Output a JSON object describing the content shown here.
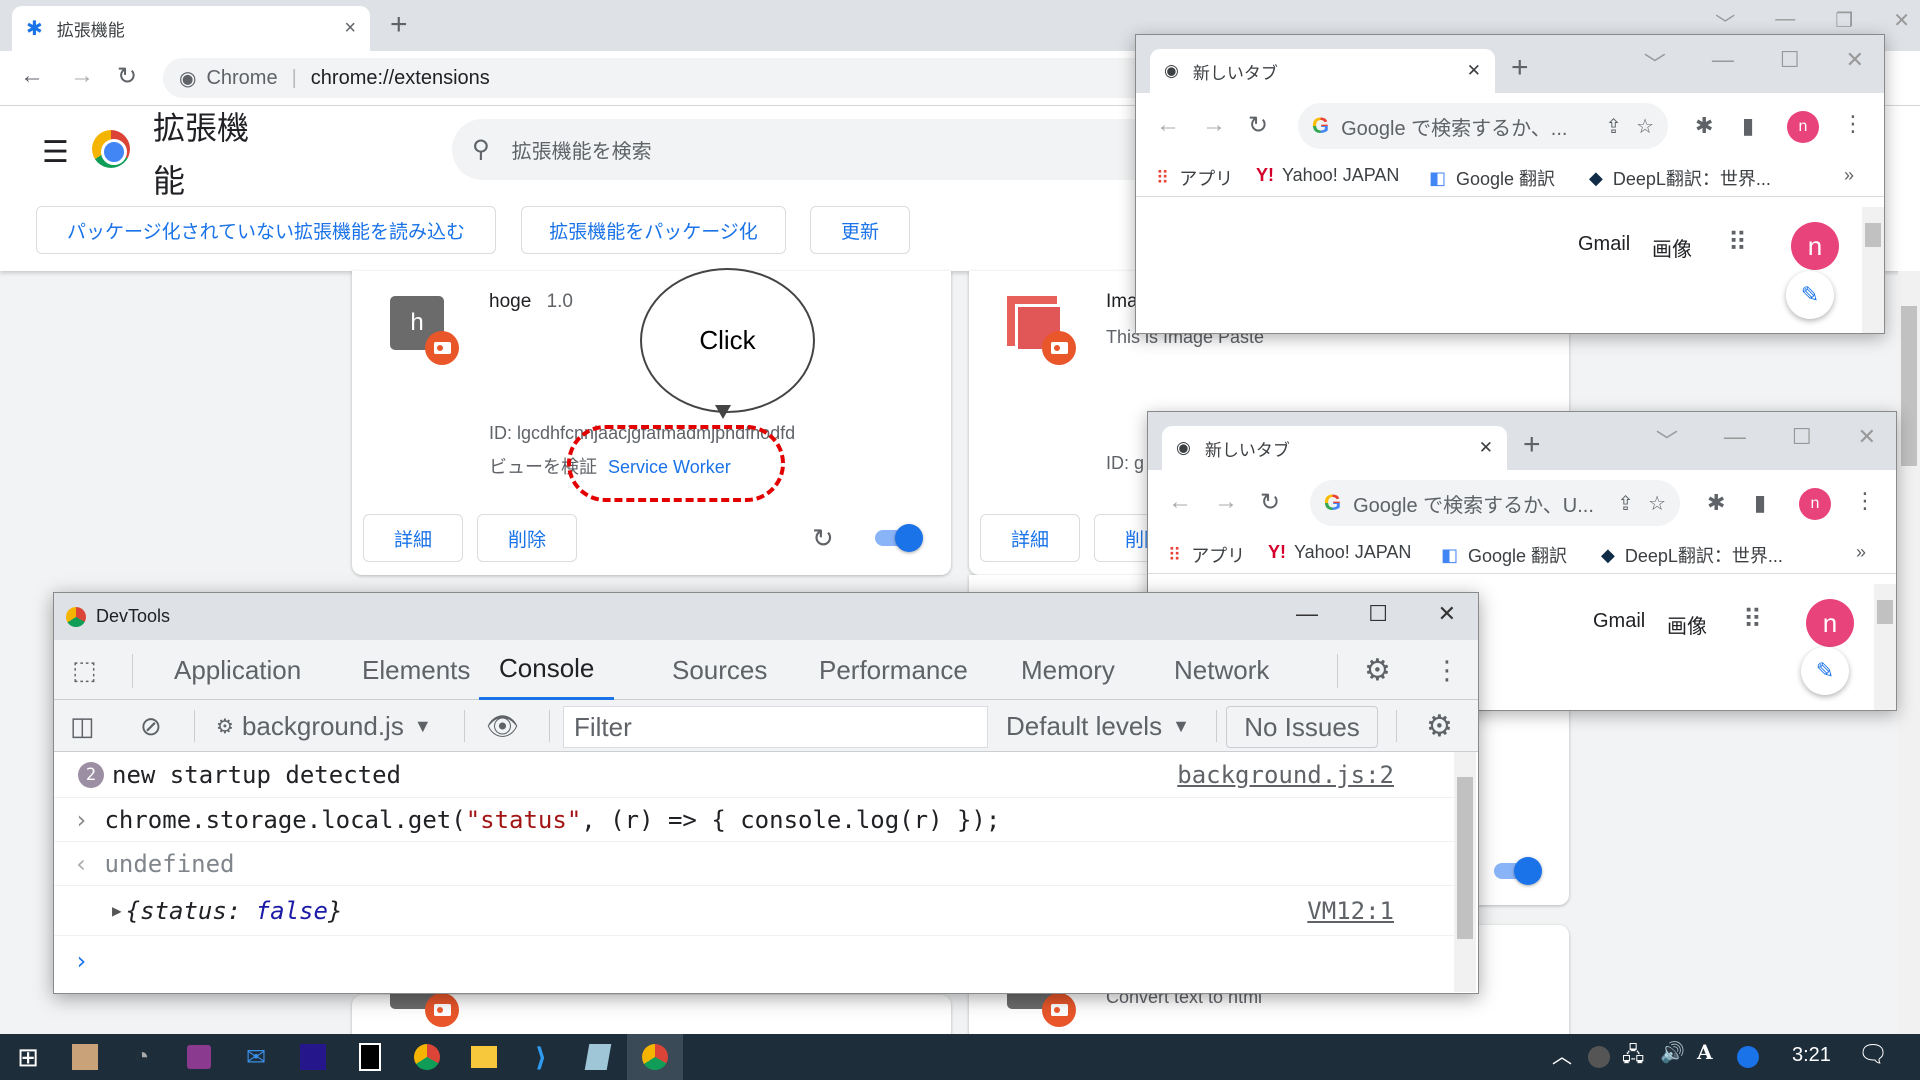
{
  "main_window": {
    "tab_title": "拡張機能",
    "tab_close": "×",
    "new_tab": "+",
    "omnibox_site": "Chrome",
    "omnibox_url": "chrome://extensions",
    "win_controls": [
      "﹀",
      "—",
      "❐",
      "✕"
    ]
  },
  "extensions_page": {
    "title": "拡張機能",
    "search_placeholder": "拡張機能を検索",
    "buttons": {
      "load_unpacked": "パッケージ化されていない拡張機能を読み込む",
      "pack": "拡張機能をパッケージ化",
      "update": "更新"
    },
    "cards": [
      {
        "icon_letter": "h",
        "name": "hoge",
        "version": "1.0",
        "id_text": "ID: lgcdhfcnnjaacjgfafmadmjpndfhodfd",
        "inspect_label": "ビューを検証",
        "inspect_link": "Service Worker",
        "details_label": "詳細",
        "remove_label": "削除",
        "enabled": true
      },
      {
        "name": "Ima",
        "description": "This is Image Paste",
        "id_text": "ID: g",
        "details_label": "詳細",
        "remove_label": "削除",
        "enabled": true
      },
      {
        "description": "Convert text to html"
      }
    ]
  },
  "annotation": {
    "bubble_text": "Click"
  },
  "popup_windows": [
    {
      "tab_title": "新しいタブ",
      "omnibox_text": "Google で検索するか、...",
      "bookmarks": [
        "アプリ",
        "Yahoo! JAPAN",
        "Google 翻訳",
        "DeepL翻訳：世界..."
      ],
      "overflow": "»",
      "links": [
        "Gmail",
        "画像"
      ],
      "avatar_letter": "n"
    },
    {
      "tab_title": "新しいタブ",
      "omnibox_text": "Google で検索するか、U...",
      "bookmarks": [
        "アプリ",
        "Yahoo! JAPAN",
        "Google 翻訳",
        "DeepL翻訳：世界..."
      ],
      "overflow": "»",
      "links": [
        "Gmail",
        "画像"
      ],
      "avatar_letter": "n"
    }
  ],
  "devtools": {
    "title": "DevTools",
    "tabs": [
      "Application",
      "Elements",
      "Console",
      "Sources",
      "Performance",
      "Memory",
      "Network"
    ],
    "active_tab": "Console",
    "context": "background.js",
    "filter_placeholder": "Filter",
    "levels": "Default levels",
    "issues": "No Issues",
    "console": [
      {
        "type": "log",
        "count": "2",
        "text": "new startup detected",
        "source": "background.js:2"
      },
      {
        "type": "input",
        "prefix": "chrome.storage.local.get(",
        "string": "\"status\"",
        "suffix": ", (r) => { console.log(r) });"
      },
      {
        "type": "return",
        "text": "undefined"
      },
      {
        "type": "object",
        "key": "status",
        "value": "false",
        "source": "VM12:1"
      }
    ]
  },
  "taskbar": {
    "clock": "3:21",
    "tray_ime": "A"
  }
}
